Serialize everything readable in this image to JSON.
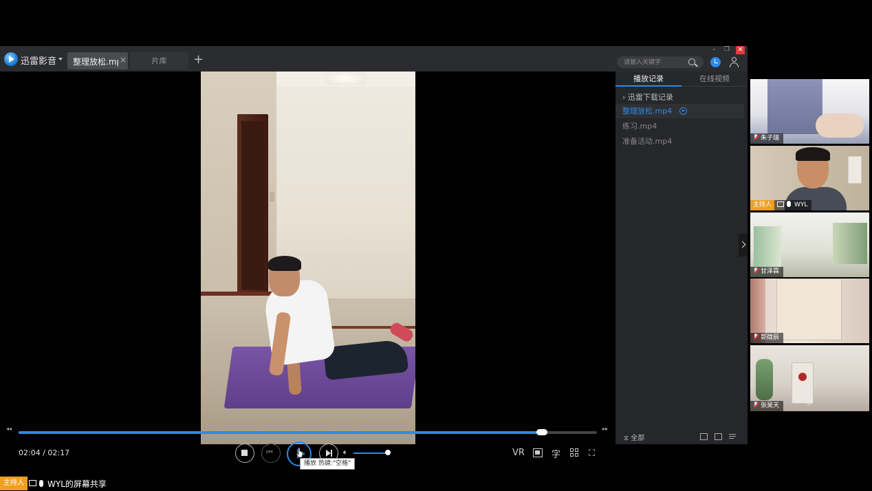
{
  "app": {
    "name": "迅雷影音"
  },
  "tabs": {
    "active_label": "整理放松.mp4",
    "close": "×",
    "library": "片库",
    "add": "+"
  },
  "search": {
    "placeholder": "请输入关键字"
  },
  "window_controls": {
    "minimize": "–",
    "restore": "❐",
    "close": "✕"
  },
  "player": {
    "time": "02:04 / 02:17",
    "progress_fraction": 0.905,
    "volume_fraction": 0.9,
    "tooltip": "播放 热键:\"空格\"",
    "vr_label": "VR",
    "subtitle_label": "字",
    "rewind": "◂◂",
    "forward": "▸▸"
  },
  "sidebar": {
    "tabs": [
      "播放记录",
      "在线视频"
    ],
    "download_section": "› 迅雷下载记录",
    "items": [
      "整理放松.mp4",
      "练习.mp4",
      "准备活动.mp4"
    ],
    "filter_label": "全部",
    "filter_icon": "⧖"
  },
  "participants": [
    {
      "name": "朱子瑞"
    },
    {
      "name": "WYL",
      "host_label": "主持人"
    },
    {
      "name": "甘泽霖"
    },
    {
      "name": "郭徵辰"
    },
    {
      "name": "张昊天"
    }
  ],
  "share_bar": {
    "host_label": "主持人",
    "text": "WYL的屏幕共享"
  },
  "colors": {
    "accent": "#2f8ae6",
    "host_badge": "#f0a020",
    "close": "#e03a3a"
  }
}
